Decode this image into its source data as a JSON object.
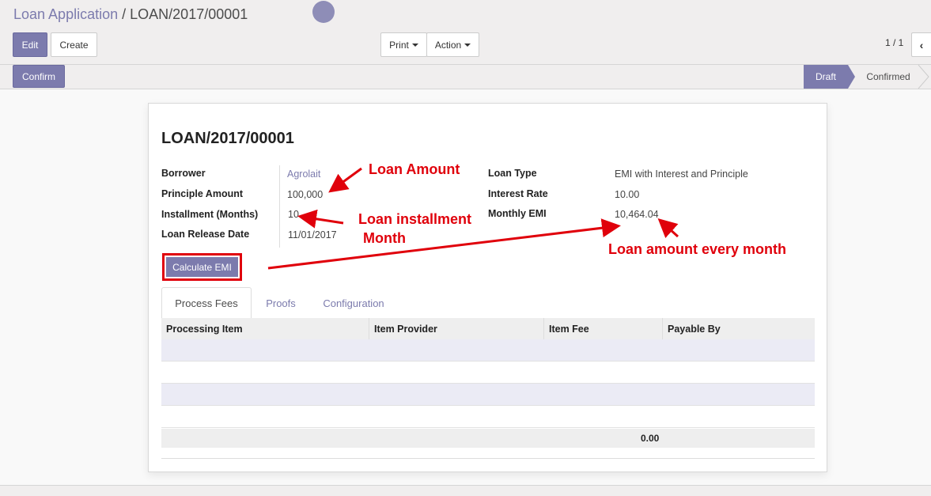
{
  "breadcrumb": {
    "parent": "Loan Application",
    "separator": "/",
    "current": "LOAN/2017/00001"
  },
  "toolbar": {
    "edit": "Edit",
    "create": "Create",
    "print": "Print",
    "action": "Action"
  },
  "pager": {
    "value": "1 / 1",
    "prev_icon": "‹"
  },
  "statusbar": {
    "confirm": "Confirm",
    "stages": [
      "Draft",
      "Confirmed"
    ],
    "active_stage": "Draft"
  },
  "record": {
    "title": "LOAN/2017/00001",
    "fields_left": [
      {
        "label": "Borrower",
        "value": "Agrolait"
      },
      {
        "label": "Principle Amount",
        "value": "100,000"
      },
      {
        "label": "Installment (Months)",
        "value": "10"
      },
      {
        "label": "Loan Release Date",
        "value": "11/01/2017"
      }
    ],
    "fields_right": [
      {
        "label": "Loan Type",
        "value": "EMI with Interest and Principle"
      },
      {
        "label": "Interest Rate",
        "value": "10.00"
      },
      {
        "label": "Monthly EMI",
        "value": "10,464.04"
      }
    ],
    "calculate_button": "Calculate EMI"
  },
  "tabs": [
    "Process Fees",
    "Proofs",
    "Configuration"
  ],
  "table": {
    "columns": [
      "Processing Item",
      "Item Provider",
      "Item Fee",
      "Payable By"
    ],
    "total": "0.00"
  },
  "annotations": {
    "loan_amount": "Loan Amount",
    "installment_line1": "Loan installment",
    "installment_line2": "Month",
    "every_month": "Loan amount every month"
  },
  "colors": {
    "brand": "#7c7bad",
    "annotation": "#e0000b"
  }
}
